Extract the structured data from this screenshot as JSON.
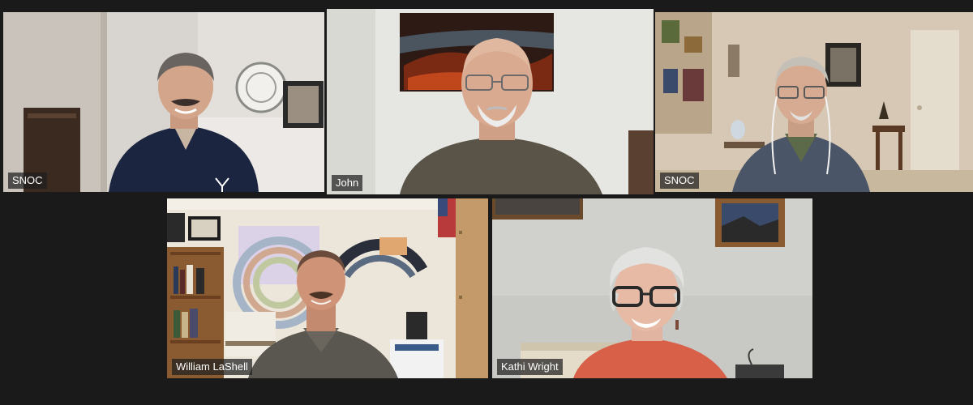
{
  "meeting": {
    "layout": "gallery-view",
    "active_speaker_color": "#d4ec4c",
    "participants": [
      {
        "name": "SNOC",
        "active": false
      },
      {
        "name": "John",
        "active": true
      },
      {
        "name": "SNOC",
        "active": false
      },
      {
        "name": "William LaShell",
        "active": false
      },
      {
        "name": "Kathi Wright",
        "active": false
      }
    ]
  }
}
